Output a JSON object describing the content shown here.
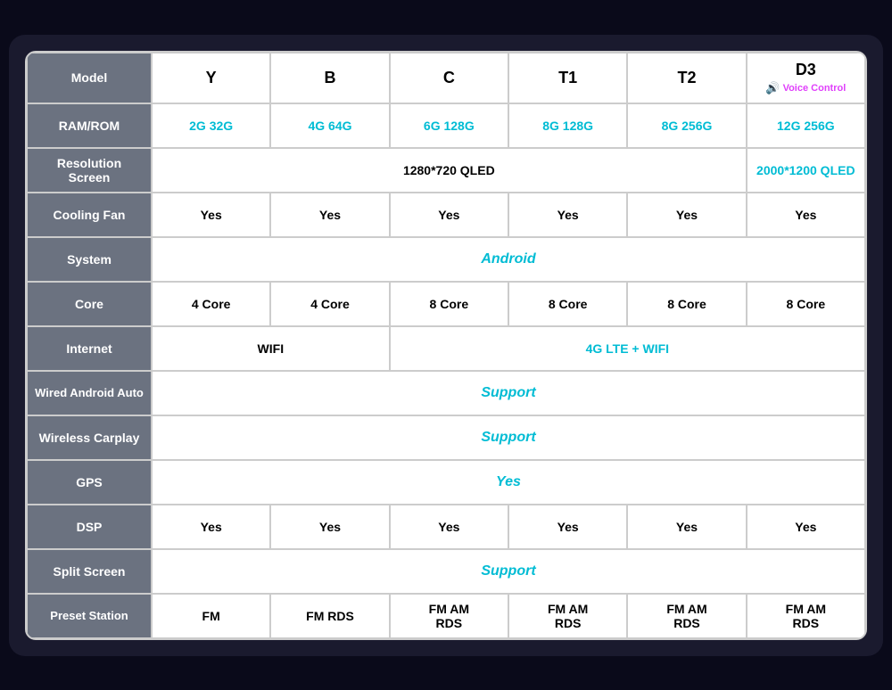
{
  "table": {
    "headers": {
      "model": "Model",
      "ram_rom": "RAM/ROM",
      "resolution": "Resolution\nScreen",
      "cooling_fan": "Cooling Fan",
      "system": "System",
      "core": "Core",
      "internet": "Internet",
      "wired_android_auto": "Wired Android Auto",
      "wireless_carplay": "Wireless Carplay",
      "gps": "GPS",
      "dsp": "DSP",
      "split_screen": "Split Screen",
      "preset_station": "Preset Station"
    },
    "models": [
      "Y",
      "B",
      "C",
      "T1",
      "T2",
      "D3"
    ],
    "ram_rom": [
      "2G 32G",
      "4G 64G",
      "6G 128G",
      "8G 128G",
      "8G 256G",
      "12G 256G"
    ],
    "resolution_standard": "1280*720 QLED",
    "resolution_d3": "2000*1200 QLED",
    "cooling_fan": [
      "Yes",
      "Yes",
      "Yes",
      "Yes",
      "Yes",
      "Yes"
    ],
    "system": "Android",
    "cores": [
      "4 Core",
      "4 Core",
      "8 Core",
      "8 Core",
      "8 Core",
      "8 Core"
    ],
    "internet_wifi": "WIFI",
    "internet_lte": "4G LTE + WIFI",
    "wired_android_auto": "Support",
    "wireless_carplay": "Support",
    "gps": "Yes",
    "dsp": [
      "Yes",
      "Yes",
      "Yes",
      "Yes",
      "Yes",
      "Yes"
    ],
    "split_screen": "Support",
    "preset_station": [
      "FM",
      "FM RDS",
      "FM AM\nRDS",
      "FM AM\nRDS",
      "FM AM\nRDS",
      "FM AM\nRDS"
    ],
    "d3_voice_label": "Voice Control",
    "d3_icon": "🔊"
  }
}
